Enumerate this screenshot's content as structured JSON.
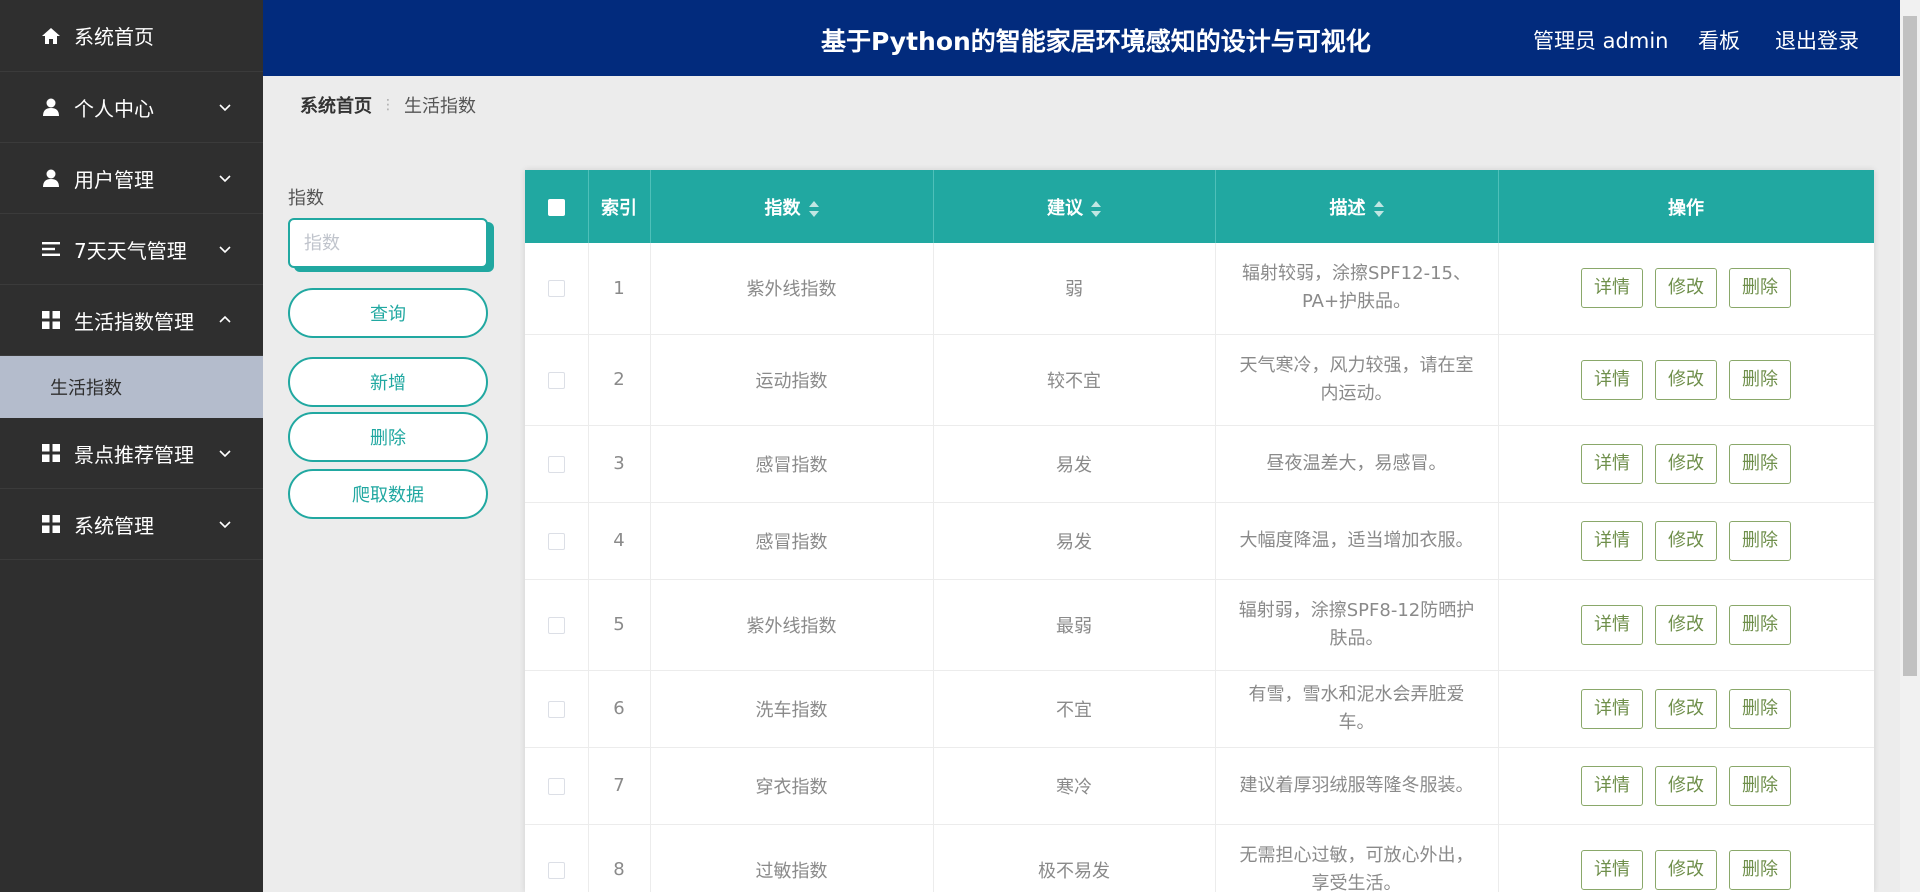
{
  "sidebar": {
    "items": [
      {
        "label": "系统首页",
        "icon": "home-icon"
      },
      {
        "label": "个人中心",
        "icon": "person-icon"
      },
      {
        "label": "用户管理",
        "icon": "person-icon"
      },
      {
        "label": "7天天气管理",
        "icon": "list-icon"
      },
      {
        "label": "生活指数管理",
        "icon": "grid-icon"
      },
      {
        "label": "景点推荐管理",
        "icon": "grid-icon"
      },
      {
        "label": "系统管理",
        "icon": "grid-icon"
      }
    ],
    "submenu": {
      "label": "生活指数"
    }
  },
  "header": {
    "title": "基于Python的智能家居环境感知的设计与可视化",
    "user": "管理员 admin",
    "dashboard": "看板",
    "logout": "退出登录"
  },
  "breadcrumb": {
    "home": "系统首页",
    "current": "生活指数"
  },
  "search": {
    "label": "指数",
    "placeholder": "指数",
    "query_btn": "查询",
    "add_btn": "新增",
    "delete_btn": "删除",
    "crawl_btn": "爬取数据"
  },
  "table": {
    "headers": {
      "index": "索引",
      "zhishu": "指数",
      "jianyi": "建议",
      "miaoshu": "描述",
      "ops": "操作"
    },
    "actions": {
      "detail": "详情",
      "edit": "修改",
      "delete": "删除"
    },
    "rows": [
      {
        "index": "1",
        "zhishu": "紫外线指数",
        "jianyi": "弱",
        "miaoshu": "辐射较弱，涂擦SPF12-15、PA+护肤品。"
      },
      {
        "index": "2",
        "zhishu": "运动指数",
        "jianyi": "较不宜",
        "miaoshu": "天气寒冷，风力较强，请在室内运动。"
      },
      {
        "index": "3",
        "zhishu": "感冒指数",
        "jianyi": "易发",
        "miaoshu": "昼夜温差大，易感冒。"
      },
      {
        "index": "4",
        "zhishu": "感冒指数",
        "jianyi": "易发",
        "miaoshu": "大幅度降温，适当增加衣服。"
      },
      {
        "index": "5",
        "zhishu": "紫外线指数",
        "jianyi": "最弱",
        "miaoshu": "辐射弱，涂擦SPF8-12防晒护肤品。"
      },
      {
        "index": "6",
        "zhishu": "洗车指数",
        "jianyi": "不宜",
        "miaoshu": "有雪，雪水和泥水会弄脏爱车。"
      },
      {
        "index": "7",
        "zhishu": "穿衣指数",
        "jianyi": "寒冷",
        "miaoshu": "建议着厚羽绒服等隆冬服装。"
      },
      {
        "index": "8",
        "zhishu": "过敏指数",
        "jianyi": "极不易发",
        "miaoshu": "无需担心过敏，可放心外出，享受生活。"
      }
    ]
  },
  "colors": {
    "sidebar": "#2f2f2f",
    "header": "#022b7d",
    "accent": "#21a8a1",
    "submenu_active": "#b4bccc",
    "op_button": "#6f8f4b"
  }
}
